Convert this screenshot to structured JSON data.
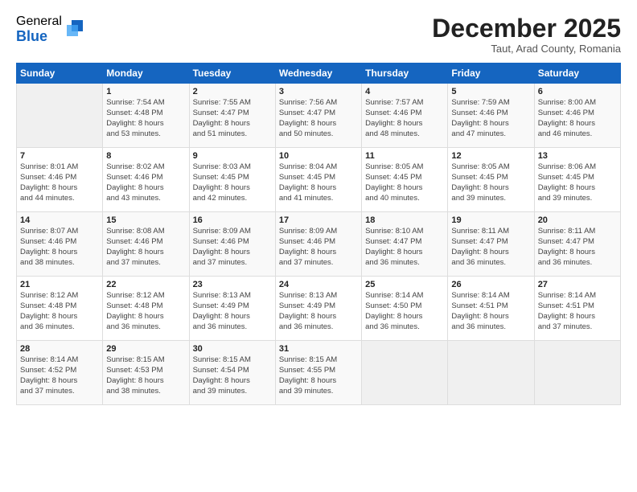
{
  "logo": {
    "general": "General",
    "blue": "Blue"
  },
  "title": "December 2025",
  "location": "Taut, Arad County, Romania",
  "days_header": [
    "Sunday",
    "Monday",
    "Tuesday",
    "Wednesday",
    "Thursday",
    "Friday",
    "Saturday"
  ],
  "weeks": [
    [
      {
        "day": "",
        "info": ""
      },
      {
        "day": "1",
        "info": "Sunrise: 7:54 AM\nSunset: 4:48 PM\nDaylight: 8 hours\nand 53 minutes."
      },
      {
        "day": "2",
        "info": "Sunrise: 7:55 AM\nSunset: 4:47 PM\nDaylight: 8 hours\nand 51 minutes."
      },
      {
        "day": "3",
        "info": "Sunrise: 7:56 AM\nSunset: 4:47 PM\nDaylight: 8 hours\nand 50 minutes."
      },
      {
        "day": "4",
        "info": "Sunrise: 7:57 AM\nSunset: 4:46 PM\nDaylight: 8 hours\nand 48 minutes."
      },
      {
        "day": "5",
        "info": "Sunrise: 7:59 AM\nSunset: 4:46 PM\nDaylight: 8 hours\nand 47 minutes."
      },
      {
        "day": "6",
        "info": "Sunrise: 8:00 AM\nSunset: 4:46 PM\nDaylight: 8 hours\nand 46 minutes."
      }
    ],
    [
      {
        "day": "7",
        "info": "Sunrise: 8:01 AM\nSunset: 4:46 PM\nDaylight: 8 hours\nand 44 minutes."
      },
      {
        "day": "8",
        "info": "Sunrise: 8:02 AM\nSunset: 4:46 PM\nDaylight: 8 hours\nand 43 minutes."
      },
      {
        "day": "9",
        "info": "Sunrise: 8:03 AM\nSunset: 4:45 PM\nDaylight: 8 hours\nand 42 minutes."
      },
      {
        "day": "10",
        "info": "Sunrise: 8:04 AM\nSunset: 4:45 PM\nDaylight: 8 hours\nand 41 minutes."
      },
      {
        "day": "11",
        "info": "Sunrise: 8:05 AM\nSunset: 4:45 PM\nDaylight: 8 hours\nand 40 minutes."
      },
      {
        "day": "12",
        "info": "Sunrise: 8:05 AM\nSunset: 4:45 PM\nDaylight: 8 hours\nand 39 minutes."
      },
      {
        "day": "13",
        "info": "Sunrise: 8:06 AM\nSunset: 4:45 PM\nDaylight: 8 hours\nand 39 minutes."
      }
    ],
    [
      {
        "day": "14",
        "info": "Sunrise: 8:07 AM\nSunset: 4:46 PM\nDaylight: 8 hours\nand 38 minutes."
      },
      {
        "day": "15",
        "info": "Sunrise: 8:08 AM\nSunset: 4:46 PM\nDaylight: 8 hours\nand 37 minutes."
      },
      {
        "day": "16",
        "info": "Sunrise: 8:09 AM\nSunset: 4:46 PM\nDaylight: 8 hours\nand 37 minutes."
      },
      {
        "day": "17",
        "info": "Sunrise: 8:09 AM\nSunset: 4:46 PM\nDaylight: 8 hours\nand 37 minutes."
      },
      {
        "day": "18",
        "info": "Sunrise: 8:10 AM\nSunset: 4:47 PM\nDaylight: 8 hours\nand 36 minutes."
      },
      {
        "day": "19",
        "info": "Sunrise: 8:11 AM\nSunset: 4:47 PM\nDaylight: 8 hours\nand 36 minutes."
      },
      {
        "day": "20",
        "info": "Sunrise: 8:11 AM\nSunset: 4:47 PM\nDaylight: 8 hours\nand 36 minutes."
      }
    ],
    [
      {
        "day": "21",
        "info": "Sunrise: 8:12 AM\nSunset: 4:48 PM\nDaylight: 8 hours\nand 36 minutes."
      },
      {
        "day": "22",
        "info": "Sunrise: 8:12 AM\nSunset: 4:48 PM\nDaylight: 8 hours\nand 36 minutes."
      },
      {
        "day": "23",
        "info": "Sunrise: 8:13 AM\nSunset: 4:49 PM\nDaylight: 8 hours\nand 36 minutes."
      },
      {
        "day": "24",
        "info": "Sunrise: 8:13 AM\nSunset: 4:49 PM\nDaylight: 8 hours\nand 36 minutes."
      },
      {
        "day": "25",
        "info": "Sunrise: 8:14 AM\nSunset: 4:50 PM\nDaylight: 8 hours\nand 36 minutes."
      },
      {
        "day": "26",
        "info": "Sunrise: 8:14 AM\nSunset: 4:51 PM\nDaylight: 8 hours\nand 36 minutes."
      },
      {
        "day": "27",
        "info": "Sunrise: 8:14 AM\nSunset: 4:51 PM\nDaylight: 8 hours\nand 37 minutes."
      }
    ],
    [
      {
        "day": "28",
        "info": "Sunrise: 8:14 AM\nSunset: 4:52 PM\nDaylight: 8 hours\nand 37 minutes."
      },
      {
        "day": "29",
        "info": "Sunrise: 8:15 AM\nSunset: 4:53 PM\nDaylight: 8 hours\nand 38 minutes."
      },
      {
        "day": "30",
        "info": "Sunrise: 8:15 AM\nSunset: 4:54 PM\nDaylight: 8 hours\nand 39 minutes."
      },
      {
        "day": "31",
        "info": "Sunrise: 8:15 AM\nSunset: 4:55 PM\nDaylight: 8 hours\nand 39 minutes."
      },
      {
        "day": "",
        "info": ""
      },
      {
        "day": "",
        "info": ""
      },
      {
        "day": "",
        "info": ""
      }
    ]
  ]
}
